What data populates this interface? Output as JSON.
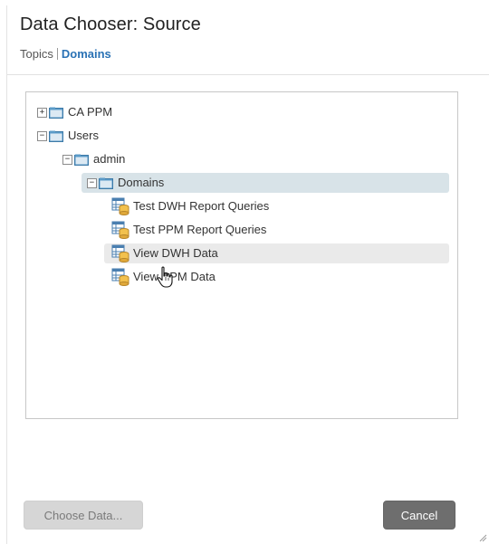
{
  "dialog": {
    "title": "Data Chooser: Source",
    "subnav": {
      "topics": "Topics",
      "domains": "Domains"
    }
  },
  "tree": {
    "nodes": [
      {
        "label": "CA PPM",
        "type": "folder",
        "expanded": false
      },
      {
        "label": "Users",
        "type": "folder",
        "expanded": true
      },
      {
        "label": "admin",
        "type": "folder",
        "expanded": true
      },
      {
        "label": "Domains",
        "type": "folder",
        "expanded": true,
        "state": "selected"
      },
      {
        "label": "Test DWH Report Queries",
        "type": "domain"
      },
      {
        "label": "Test PPM Report Queries",
        "type": "domain"
      },
      {
        "label": "View DWH Data",
        "type": "domain",
        "state": "hover"
      },
      {
        "label": "View PPM Data",
        "type": "domain"
      }
    ]
  },
  "buttons": {
    "choose": "Choose Data...",
    "cancel": "Cancel"
  },
  "colors": {
    "accent": "#2a72b5",
    "selected_row": "#d8e3e8",
    "hover_row": "#eaeaea",
    "cancel_button": "#6e6e6e"
  },
  "icons": {
    "folder": "folder-icon",
    "domain": "domain-icon",
    "expand": "plus-icon",
    "collapse": "minus-icon"
  }
}
